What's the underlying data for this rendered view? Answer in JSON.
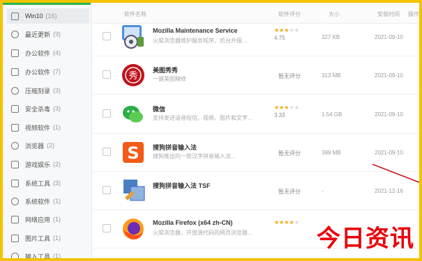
{
  "sidebar": {
    "items": [
      {
        "label": "Win10",
        "count": "(16)"
      },
      {
        "label": "最近更新",
        "count": "(9)"
      },
      {
        "label": "办公软件",
        "count": "(4)"
      },
      {
        "label": "办公软件",
        "count": "(7)"
      },
      {
        "label": "压缩刻录",
        "count": "(3)"
      },
      {
        "label": "安全杀毒",
        "count": "(3)"
      },
      {
        "label": "视频软件",
        "count": "(1)"
      },
      {
        "label": "浏览器",
        "count": "(2)"
      },
      {
        "label": "游戏娱乐",
        "count": "(2)"
      },
      {
        "label": "系统工具",
        "count": "(3)"
      },
      {
        "label": "系统软件",
        "count": "(1)"
      },
      {
        "label": "网络应用",
        "count": "(1)"
      },
      {
        "label": "图片工具",
        "count": "(1)"
      },
      {
        "label": "输入工具",
        "count": "(1)"
      }
    ]
  },
  "header": {
    "col_name": "软件名称",
    "col_rating": "软件评分",
    "col_size": "大小",
    "col_date": "安装时间",
    "col_action": "操作"
  },
  "apps": [
    {
      "name": "Mozilla Maintenance Service",
      "desc": "火狐浏览器维护服务程序，后台升级…",
      "stars": 3,
      "score": "4.75",
      "size": "327 KB",
      "date": "2021-09-10",
      "icon": "mozilla-maintenance-icon"
    },
    {
      "name": "美图秀秀",
      "desc": "一键美图精修",
      "rating_text": "暂无评分",
      "size": "313 MB",
      "date": "2021-09-10",
      "icon": "meitu-icon"
    },
    {
      "name": "微信",
      "desc": "支持发送语音短信、视频、图片和文字…",
      "stars": 3,
      "score": "3.33",
      "size": "1.54 GB",
      "date": "2021-09-10",
      "icon": "wechat-icon"
    },
    {
      "name": "搜狗拼音输入法",
      "desc": "搜狗推出的一款汉字拼音输入法…",
      "rating_text": "暂无评分",
      "size": "399 MB",
      "date": "2021-09-10",
      "icon": "sogou-icon"
    },
    {
      "name": "搜狗拼音输入法 TSF",
      "desc": "",
      "rating_text": "暂无评分",
      "size": "-",
      "date": "2021-12-16",
      "icon": "sogou-tsf-icon"
    },
    {
      "name": "Mozilla Firefox (x64 zh-CN)",
      "desc": "火狐浏览器，开放源代码的网页浏览器…",
      "stars": 4,
      "score": "",
      "size": "",
      "date": "",
      "icon": "firefox-icon"
    }
  ],
  "watermark": "今日资讯",
  "colors": {
    "accent": "#2bb24c",
    "border": "#f4c200",
    "watermark": "#e8000b",
    "star": "#f0a400"
  }
}
